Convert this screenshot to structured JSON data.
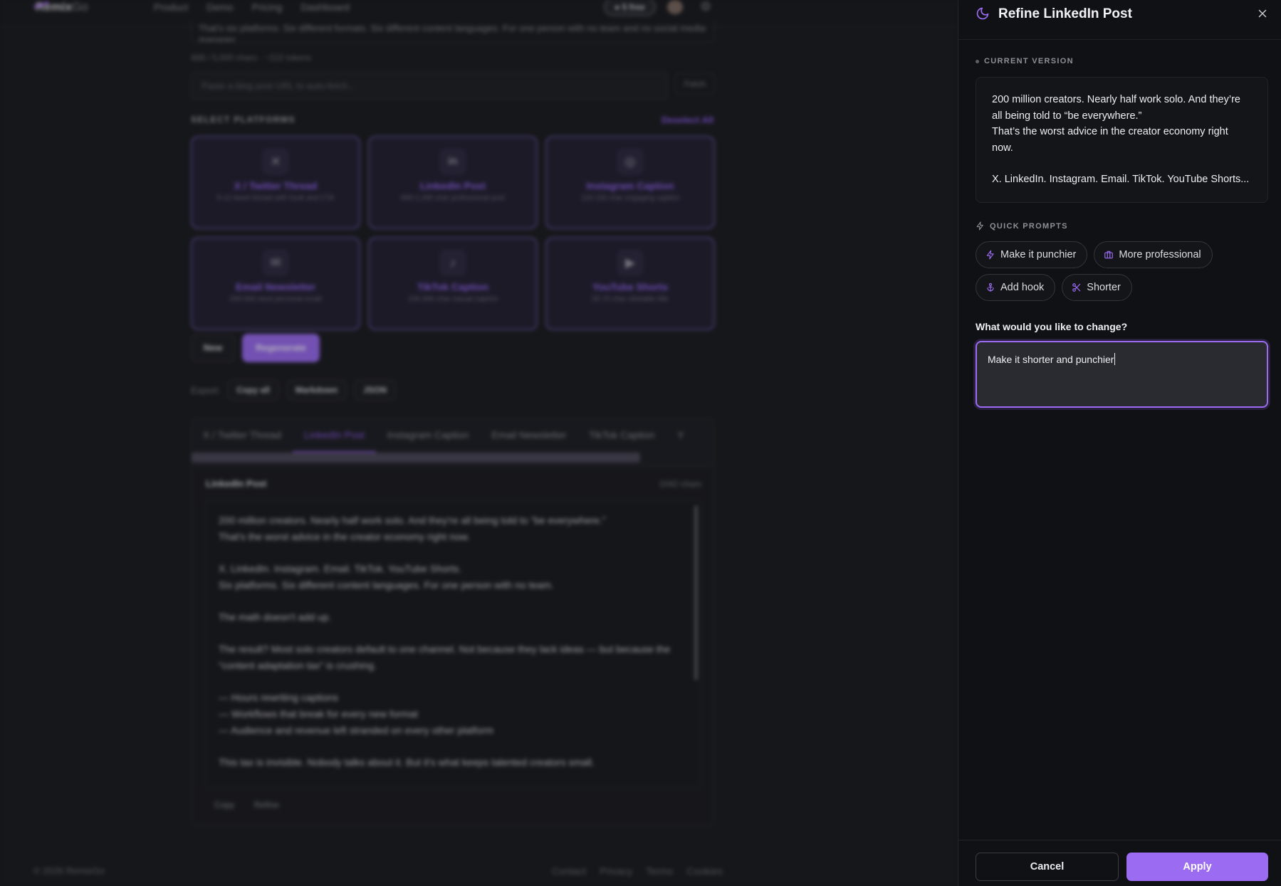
{
  "nav": {
    "logo": "Remix",
    "logo_suffix": "Go",
    "links": [
      "Product",
      "Demo",
      "Pricing",
      "Dashboard"
    ],
    "free_badge": "5 free"
  },
  "source": {
    "text_preview": "That's six platforms. Six different formats. Six different content languages. For one person with no team and no social media manager.",
    "counts": "888 / 5,000 chars · ~222 tokens",
    "url_placeholder": "Paste a blog post URL to auto-fetch...",
    "fetch_label": "Fetch"
  },
  "platforms": {
    "section_label": "SELECT PLATFORMS",
    "deselect_label": "Deselect All",
    "items": [
      {
        "title": "X / Twitter Thread",
        "desc": "5-12 tweet thread with hook and CTA",
        "icon": "x-logo-icon"
      },
      {
        "title": "LinkedIn Post",
        "desc": "800-1,200 char professional post",
        "icon": "linkedin-icon"
      },
      {
        "title": "Instagram Caption",
        "desc": "120-150 char engaging caption",
        "icon": "instagram-icon"
      },
      {
        "title": "Email Newsletter",
        "desc": "200-500 word personal email",
        "icon": "mail-icon"
      },
      {
        "title": "TikTok Caption",
        "desc": "100-300 char casual caption",
        "icon": "tiktok-icon"
      },
      {
        "title": "YouTube Shorts",
        "desc": "50-70 char clickable title",
        "icon": "youtube-icon"
      }
    ]
  },
  "actions": {
    "new_label": "New",
    "regenerate_label": "Regenerate",
    "export_label": "Export:",
    "export_options": [
      "Copy all",
      "Markdown",
      "JSON"
    ]
  },
  "results": {
    "tabs": [
      "X / Twitter Thread",
      "LinkedIn Post",
      "Instagram Caption",
      "Email Newsletter",
      "TikTok Caption",
      "Y"
    ],
    "active_tab": "LinkedIn Post",
    "panel_title": "LinkedIn Post",
    "char_count": "1042 chars",
    "paragraphs": [
      "200 million creators. Nearly half work solo. And they're all being told to “be everywhere.”\nThat's the worst advice in the creator economy right now.",
      "X. LinkedIn. Instagram. Email. TikTok. YouTube Shorts.\nSix platforms. Six different content languages. For one person with no team.",
      "The math doesn't add up.",
      "The result? Most solo creators default to one channel. Not because they lack ideas — but because the “content adaptation tax” is crushing.",
      "— Hours rewriting captions\n— Workflows that break for every new format\n— Audience and revenue left stranded on every other platform",
      "This tax is invisible. Nobody talks about it. But it's what keeps talented creators small."
    ],
    "copy_label": "Copy",
    "refine_label": "Refine"
  },
  "footer": {
    "copyright": "© 2026 RemixGo",
    "links": [
      "Contact",
      "Privacy",
      "Terms",
      "Cookies"
    ]
  },
  "refine_panel": {
    "title": "Refine LinkedIn Post",
    "current_version_label": "CURRENT VERSION",
    "current_version_paragraphs": [
      "200 million creators. Nearly half work solo. And they’re all being told to “be everywhere.”\nThat’s the worst advice in the creator economy right now.",
      "X. LinkedIn. Instagram. Email. TikTok. YouTube Shorts..."
    ],
    "quick_prompts_label": "QUICK PROMPTS",
    "quick_prompts": [
      {
        "label": "Make it punchier",
        "icon": "lightning-icon"
      },
      {
        "label": "More professional",
        "icon": "briefcase-icon"
      },
      {
        "label": "Add hook",
        "icon": "anchor-icon"
      },
      {
        "label": "Shorter",
        "icon": "scissors-icon"
      }
    ],
    "change_label": "What would you like to change?",
    "change_value": "Make it shorter and punchier",
    "cancel_label": "Cancel",
    "apply_label": "Apply"
  },
  "colors": {
    "accent": "#9b6cf2",
    "panel_bg": "#101115",
    "page_bg": "#1b1c20"
  }
}
